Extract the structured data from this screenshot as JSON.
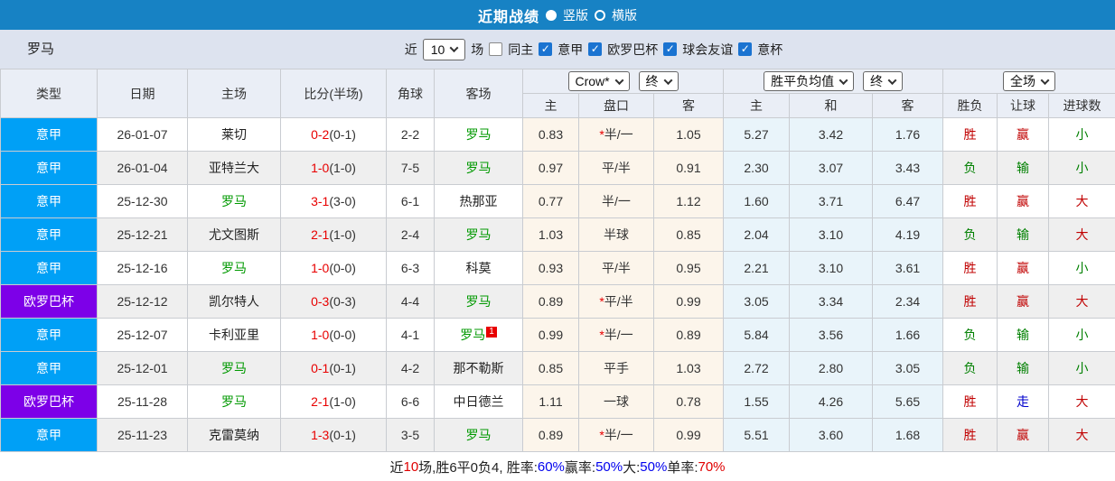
{
  "titlebar": {
    "title": "近期战绩",
    "radio_vertical": "竖版",
    "radio_horizontal": "横版"
  },
  "filter": {
    "team": "罗马",
    "near_label": "近",
    "match_count": "10",
    "games_label": "场",
    "same_home_label": "同主",
    "leagues": [
      "意甲",
      "欧罗巴杯",
      "球会友谊",
      "意杯"
    ]
  },
  "table": {
    "left_headers": [
      "类型",
      "日期",
      "主场",
      "比分(半场)",
      "角球",
      "客场"
    ],
    "selects": {
      "odds_company": "Crow*",
      "odds_time": "终",
      "avg_label": "胜平负均值",
      "avg_time": "终",
      "scope": "全场"
    },
    "sub_headers": [
      "主",
      "盘口",
      "客",
      "主",
      "和",
      "客",
      "胜负",
      "让球",
      "进球数"
    ],
    "rows": [
      {
        "league": "意甲",
        "league_color": "blue",
        "date": "26-01-07",
        "home": "莱切",
        "home_roma": false,
        "score_ft": "0-2",
        "score_ht": "(0-1)",
        "corner": "2-2",
        "away": "罗马",
        "away_roma": true,
        "odds_home": "0.83",
        "handicap_star": true,
        "handicap": "半/一",
        "odds_away": "1.05",
        "avg_home": "5.27",
        "avg_draw": "3.42",
        "avg_away": "1.76",
        "result": "胜",
        "result_color": "red",
        "handicap_result": "赢",
        "handicap_result_color": "red",
        "goals": "小",
        "goals_color": "green"
      },
      {
        "league": "意甲",
        "league_color": "blue",
        "date": "26-01-04",
        "home": "亚特兰大",
        "home_roma": false,
        "score_ft": "1-0",
        "score_ht": "(1-0)",
        "corner": "7-5",
        "away": "罗马",
        "away_roma": true,
        "odds_home": "0.97",
        "handicap_star": false,
        "handicap": "平/半",
        "odds_away": "0.91",
        "avg_home": "2.30",
        "avg_draw": "3.07",
        "avg_away": "3.43",
        "result": "负",
        "result_color": "green",
        "handicap_result": "输",
        "handicap_result_color": "green",
        "goals": "小",
        "goals_color": "green"
      },
      {
        "league": "意甲",
        "league_color": "blue",
        "date": "25-12-30",
        "home": "罗马",
        "home_roma": true,
        "score_ft": "3-1",
        "score_ht": "(3-0)",
        "corner": "6-1",
        "away": "热那亚",
        "away_roma": false,
        "odds_home": "0.77",
        "handicap_star": false,
        "handicap": "半/一",
        "odds_away": "1.12",
        "avg_home": "1.60",
        "avg_draw": "3.71",
        "avg_away": "6.47",
        "result": "胜",
        "result_color": "red",
        "handicap_result": "赢",
        "handicap_result_color": "red",
        "goals": "大",
        "goals_color": "red"
      },
      {
        "league": "意甲",
        "league_color": "blue",
        "date": "25-12-21",
        "home": "尤文图斯",
        "home_roma": false,
        "score_ft": "2-1",
        "score_ht": "(1-0)",
        "corner": "2-4",
        "away": "罗马",
        "away_roma": true,
        "odds_home": "1.03",
        "handicap_star": false,
        "handicap": "半球",
        "odds_away": "0.85",
        "avg_home": "2.04",
        "avg_draw": "3.10",
        "avg_away": "4.19",
        "result": "负",
        "result_color": "green",
        "handicap_result": "输",
        "handicap_result_color": "green",
        "goals": "大",
        "goals_color": "red"
      },
      {
        "league": "意甲",
        "league_color": "blue",
        "date": "25-12-16",
        "home": "罗马",
        "home_roma": true,
        "score_ft": "1-0",
        "score_ht": "(0-0)",
        "corner": "6-3",
        "away": "科莫",
        "away_roma": false,
        "odds_home": "0.93",
        "handicap_star": false,
        "handicap": "平/半",
        "odds_away": "0.95",
        "avg_home": "2.21",
        "avg_draw": "3.10",
        "avg_away": "3.61",
        "result": "胜",
        "result_color": "red",
        "handicap_result": "赢",
        "handicap_result_color": "red",
        "goals": "小",
        "goals_color": "green"
      },
      {
        "league": "欧罗巴杯",
        "league_color": "purple",
        "date": "25-12-12",
        "home": "凯尔特人",
        "home_roma": false,
        "score_ft": "0-3",
        "score_ht": "(0-3)",
        "corner": "4-4",
        "away": "罗马",
        "away_roma": true,
        "odds_home": "0.89",
        "handicap_star": true,
        "handicap": "平/半",
        "odds_away": "0.99",
        "avg_home": "3.05",
        "avg_draw": "3.34",
        "avg_away": "2.34",
        "result": "胜",
        "result_color": "red",
        "handicap_result": "赢",
        "handicap_result_color": "red",
        "goals": "大",
        "goals_color": "red"
      },
      {
        "league": "意甲",
        "league_color": "blue",
        "date": "25-12-07",
        "home": "卡利亚里",
        "home_roma": false,
        "score_ft": "1-0",
        "score_ht": "(0-0)",
        "corner": "4-1",
        "away": "罗马",
        "away_roma": true,
        "away_badge": "1",
        "odds_home": "0.99",
        "handicap_star": true,
        "handicap": "半/一",
        "odds_away": "0.89",
        "avg_home": "5.84",
        "avg_draw": "3.56",
        "avg_away": "1.66",
        "result": "负",
        "result_color": "green",
        "handicap_result": "输",
        "handicap_result_color": "green",
        "goals": "小",
        "goals_color": "green"
      },
      {
        "league": "意甲",
        "league_color": "blue",
        "date": "25-12-01",
        "home": "罗马",
        "home_roma": true,
        "score_ft": "0-1",
        "score_ht": "(0-1)",
        "corner": "4-2",
        "away": "那不勒斯",
        "away_roma": false,
        "odds_home": "0.85",
        "handicap_star": false,
        "handicap": "平手",
        "odds_away": "1.03",
        "avg_home": "2.72",
        "avg_draw": "2.80",
        "avg_away": "3.05",
        "result": "负",
        "result_color": "green",
        "handicap_result": "输",
        "handicap_result_color": "green",
        "goals": "小",
        "goals_color": "green"
      },
      {
        "league": "欧罗巴杯",
        "league_color": "purple",
        "date": "25-11-28",
        "home": "罗马",
        "home_roma": true,
        "score_ft": "2-1",
        "score_ht": "(1-0)",
        "corner": "6-6",
        "away": "中日德兰",
        "away_roma": false,
        "odds_home": "1.11",
        "handicap_star": false,
        "handicap": "一球",
        "odds_away": "0.78",
        "avg_home": "1.55",
        "avg_draw": "4.26",
        "avg_away": "5.65",
        "result": "胜",
        "result_color": "red",
        "handicap_result": "走",
        "handicap_result_color": "blue",
        "goals": "大",
        "goals_color": "red"
      },
      {
        "league": "意甲",
        "league_color": "blue",
        "date": "25-11-23",
        "home": "克雷莫纳",
        "home_roma": false,
        "score_ft": "1-3",
        "score_ht": "(0-1)",
        "corner": "3-5",
        "away": "罗马",
        "away_roma": true,
        "odds_home": "0.89",
        "handicap_star": true,
        "handicap": "半/一",
        "odds_away": "0.99",
        "avg_home": "5.51",
        "avg_draw": "3.60",
        "avg_away": "1.68",
        "result": "胜",
        "result_color": "red",
        "handicap_result": "赢",
        "handicap_result_color": "red",
        "goals": "大",
        "goals_color": "red"
      }
    ]
  },
  "footer": {
    "segments": [
      {
        "text": "近",
        "color": "black"
      },
      {
        "text": "10",
        "color": "red"
      },
      {
        "text": "场,胜6平0负4, 胜率:",
        "color": "black"
      },
      {
        "text": "60%",
        "color": "blue"
      },
      {
        "text": " 赢率:",
        "color": "black"
      },
      {
        "text": "50%",
        "color": "blue"
      },
      {
        "text": " 大:",
        "color": "black"
      },
      {
        "text": "50%",
        "color": "blue"
      },
      {
        "text": " 单率:",
        "color": "black"
      },
      {
        "text": "70%",
        "color": "red"
      }
    ]
  },
  "colors": {
    "topbar_bg": "#1782c4",
    "filterbar_bg": "#dde3ef",
    "league_blue": "#00a0f6",
    "league_purple": "#7d00e8",
    "roma_green": "#009900",
    "score_red": "#e80000",
    "result_red": "#c00000",
    "result_green": "#008000",
    "result_blue": "#0000cc",
    "odds_bg": "#fcf5eb",
    "avg_bg": "#e9f4fa",
    "stripe_bg": "#efefef",
    "checkbox_blue": "#1a73d1"
  }
}
